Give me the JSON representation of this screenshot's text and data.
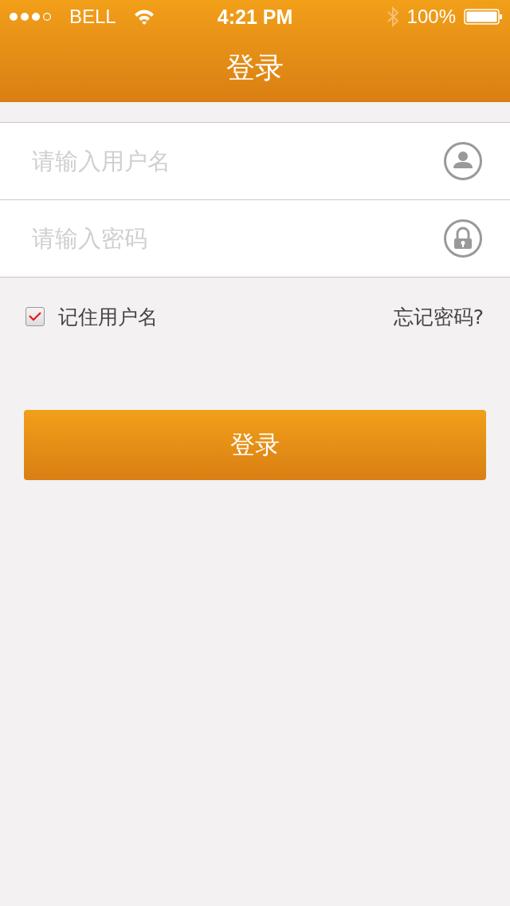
{
  "status_bar": {
    "carrier": "BELL",
    "time": "4:21 PM",
    "battery": "100%"
  },
  "nav_bar": {
    "title": "登录"
  },
  "fields": [
    {
      "kind": "user",
      "placeholder": "请输入用户名"
    },
    {
      "kind": "lock",
      "placeholder": "请输入密码"
    }
  ],
  "remember": {
    "label": "记住用户名",
    "checked": true
  },
  "forgot_link": "忘记密码?",
  "login_button": "登录"
}
